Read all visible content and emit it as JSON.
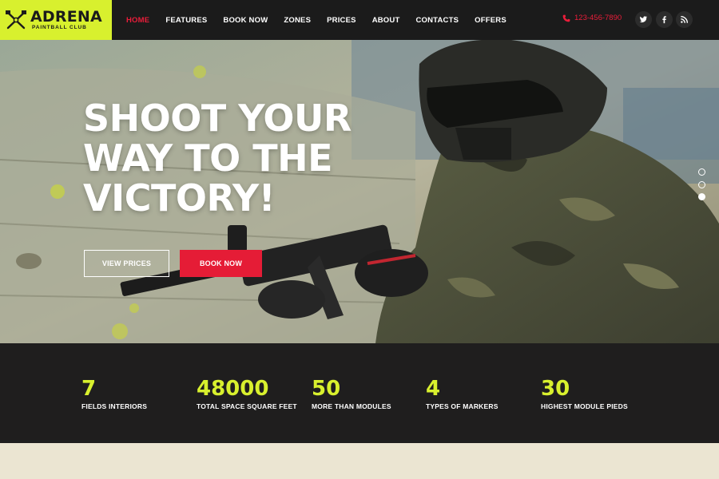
{
  "brand": {
    "name": "ADRENA",
    "tagline": "PAINTBALL CLUB",
    "accent": "#d8f02e"
  },
  "nav": {
    "items": [
      {
        "label": "HOME",
        "active": true
      },
      {
        "label": "FEATURES"
      },
      {
        "label": "BOOK NOW"
      },
      {
        "label": "ZONES"
      },
      {
        "label": "PRICES"
      },
      {
        "label": "ABOUT"
      },
      {
        "label": "CONTACTS"
      },
      {
        "label": "OFFERS"
      }
    ],
    "active_color": "#ea1d3a"
  },
  "contact": {
    "phone": "123-456-7890",
    "icon": "phone-icon"
  },
  "social": [
    {
      "icon": "twitter-icon"
    },
    {
      "icon": "facebook-icon"
    },
    {
      "icon": "rss-icon"
    }
  ],
  "hero": {
    "title_lines": [
      "SHOOT YOUR",
      "WAY TO THE",
      "VICTORY!"
    ],
    "buttons": {
      "view_prices": "VIEW PRICES",
      "book_now": "BOOK NOW"
    },
    "button_color": "#e51c36",
    "slider": {
      "count": 3,
      "active": 3
    }
  },
  "stats": [
    {
      "value": "7",
      "label": "FIELDS INTERIORS"
    },
    {
      "value": "48000",
      "label": "TOTAL SPACE SQUARE FEET"
    },
    {
      "value": "50",
      "label": "MORE THAN MODULES"
    },
    {
      "value": "4",
      "label": "TYPES OF MARKERS"
    },
    {
      "value": "30",
      "label": "HIGHEST MODULE PIEDS"
    }
  ]
}
